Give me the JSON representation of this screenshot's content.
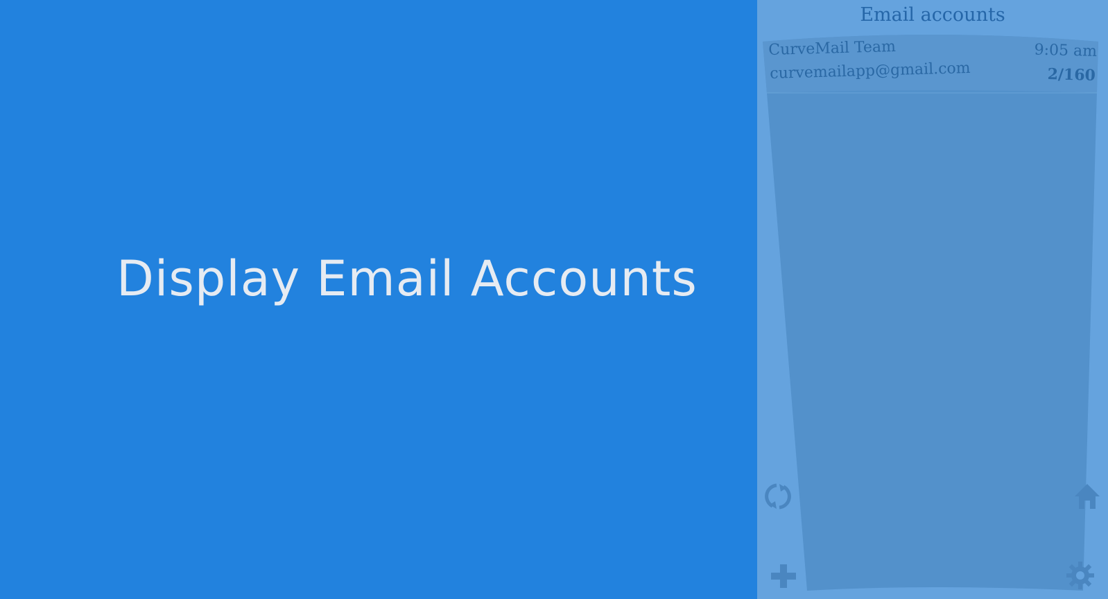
{
  "intro": {
    "heading": "Display Email Accounts"
  },
  "panel": {
    "title": "Email accounts",
    "accounts": [
      {
        "name": "CurveMail Team",
        "email": "curvemailapp@gmail.com",
        "time": "9:05 am",
        "count": "2/160"
      }
    ],
    "icons": {
      "refresh": "refresh-icon",
      "home": "home-icon",
      "add": "plus-icon",
      "settings": "gear-icon"
    }
  },
  "colors": {
    "background": "#2282de",
    "panel": "#65a3de",
    "list": "#5391cb",
    "text": "#2a68a4",
    "heading": "#e6ebf2"
  }
}
